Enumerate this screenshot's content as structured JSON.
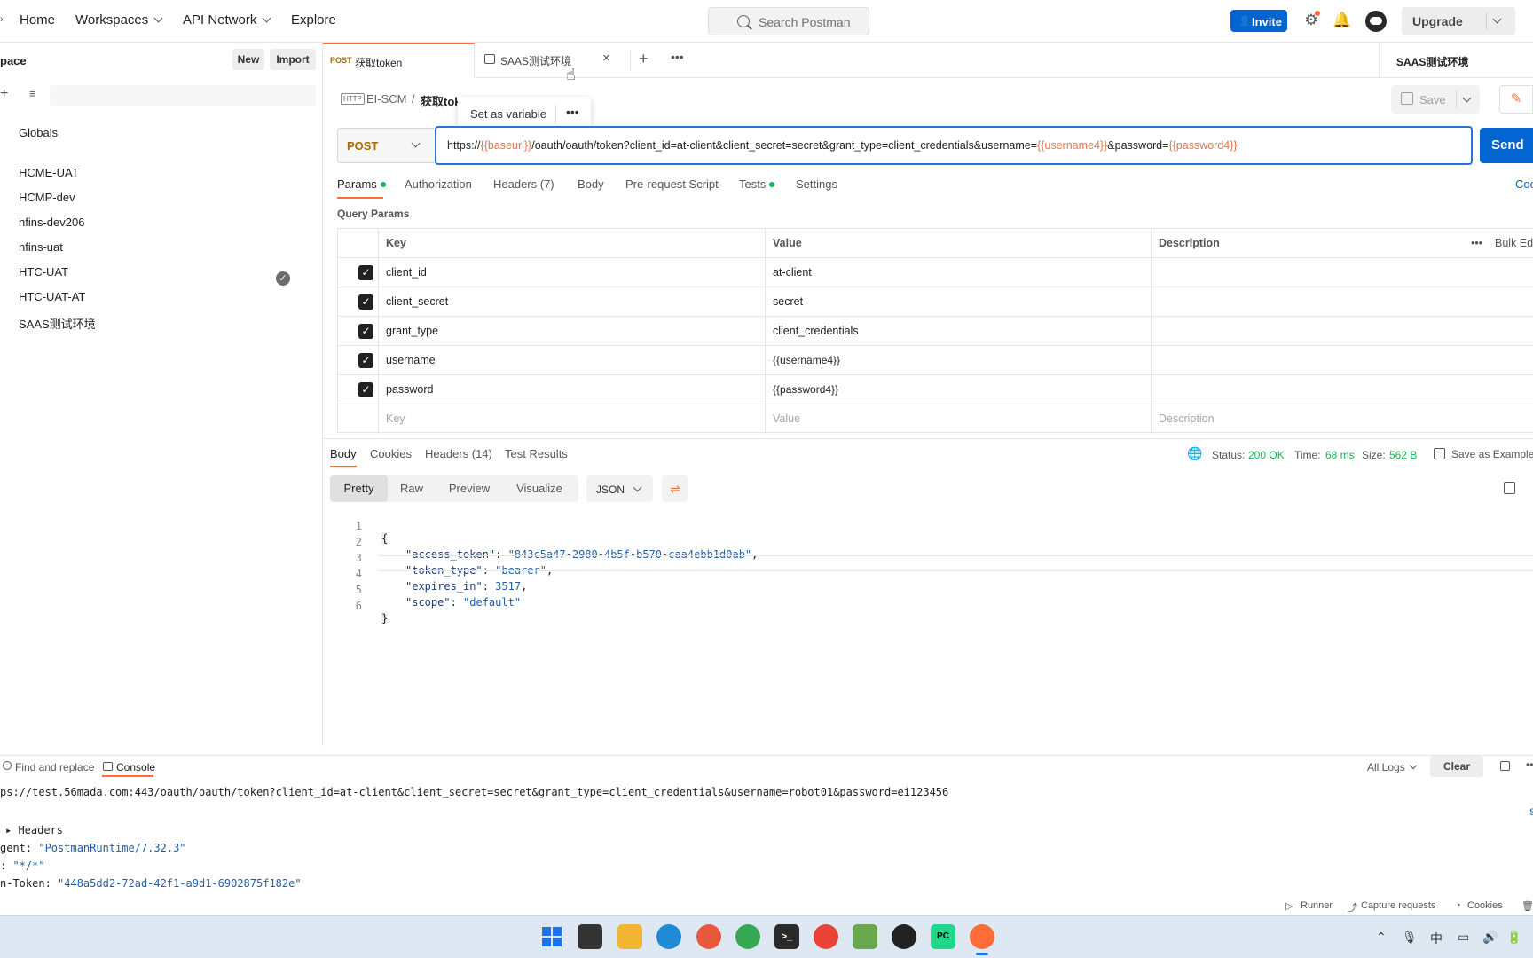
{
  "nav": {
    "home": "Home",
    "workspaces": "Workspaces",
    "api_network": "API Network",
    "explore": "Explore"
  },
  "search": {
    "placeholder": "Search Postman"
  },
  "top_actions": {
    "invite": "Invite",
    "upgrade": "Upgrade"
  },
  "sidebar": {
    "title": "pace",
    "new_label": "New",
    "import_label": "Import",
    "globals": "Globals",
    "environments": [
      "HCME-UAT",
      "HCMP-dev",
      "hfins-dev206",
      "hfins-uat",
      "HTC-UAT",
      "HTC-UAT-AT",
      "SAAS测试环境"
    ]
  },
  "tabs": {
    "tab1_method": "POST",
    "tab1_name": "获取token",
    "tab2_name": "SAAS测试环境",
    "env_selected": "SAAS测试环境"
  },
  "breadcrumb": {
    "collection": "EI-SCM",
    "sep": "/",
    "request": "获取tok"
  },
  "popup": {
    "set_as_variable": "Set as variable"
  },
  "save_label": "Save",
  "request": {
    "method": "POST",
    "url_parts": [
      "https://",
      "{{baseurl}}",
      "/oauth/oauth/token?client_id=at-client&client_secret=secret&grant_type=client_credentials&username=",
      "{{username4}}",
      "&password=",
      "{{password4}}"
    ],
    "send_label": "Send",
    "tabs": [
      "Params",
      "Authorization",
      "Headers (7)",
      "Body",
      "Pre-request Script",
      "Tests",
      "Settings"
    ],
    "code_label": "Coo"
  },
  "params": {
    "section_title": "Query Params",
    "headers": [
      "Key",
      "Value",
      "Description"
    ],
    "bulk_edit": "Bulk Ed",
    "rows": [
      {
        "key": "client_id",
        "value": "at-client"
      },
      {
        "key": "client_secret",
        "value": "secret"
      },
      {
        "key": "grant_type",
        "value": "client_credentials"
      },
      {
        "key": "username",
        "value": "{{username4}}"
      },
      {
        "key": "password",
        "value": "{{password4}}"
      }
    ],
    "placeholder_key": "Key",
    "placeholder_value": "Value",
    "placeholder_desc": "Description"
  },
  "response": {
    "tabs": [
      "Body",
      "Cookies",
      "Headers (14)",
      "Test Results"
    ],
    "status_label": "Status:",
    "status_value": "200 OK",
    "time_label": "Time:",
    "time_value": "68 ms",
    "size_label": "Size:",
    "size_value": "562 B",
    "save_example": "Save as Example",
    "views": [
      "Pretty",
      "Raw",
      "Preview",
      "Visualize"
    ],
    "format": "JSON",
    "lines": [
      {
        "n": "1",
        "text": "{"
      },
      {
        "n": "2",
        "key": "\"access_token\"",
        "val": "\"843c5a47-2980-4b5f-b570-caa4ebb1d0ab\"",
        "tail": ","
      },
      {
        "n": "3",
        "key": "\"token_type\"",
        "val": "\"bearer\"",
        "tail": ","
      },
      {
        "n": "4",
        "key": "\"expires_in\"",
        "val": "3517",
        "tail": ","
      },
      {
        "n": "5",
        "key": "\"scope\"",
        "val": "\"default\"",
        "tail": ""
      },
      {
        "n": "6",
        "text": "}"
      }
    ]
  },
  "console": {
    "find_replace": "Find and replace",
    "console_label": "Console",
    "all_logs": "All Logs",
    "clear": "Clear",
    "url_line": "ps://test.56mada.com:443/oauth/oauth/token?client_id=at-client&client_secret=secret&grant_type=client_credentials&username=robot01&password=ei123456",
    "headers_label": "Headers",
    "agent_key": "gent: ",
    "agent_val": "\"PostmanRuntime/7.32.3\"",
    "accept_key": ": ",
    "accept_val": "\"*/*\"",
    "token_key": "n-Token: ",
    "token_val": "\"448a5dd2-72ad-42f1-a9d1-6902875f182e\""
  },
  "footer": {
    "runner": "Runner",
    "capture": "Capture requests",
    "cookies": "Cookies"
  },
  "colors": {
    "accent_orange": "#ff6c37",
    "primary_blue": "#0265d2",
    "status_green": "#0cbb52",
    "variable_orange": "#e8744c"
  }
}
